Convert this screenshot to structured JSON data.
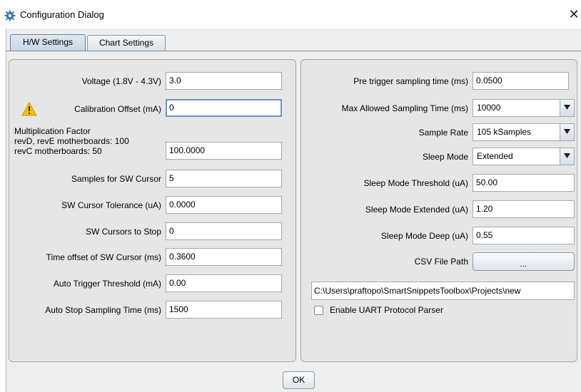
{
  "window": {
    "title": "Configuration Dialog",
    "close_glyph": "✕"
  },
  "icons": {
    "app": "gear-icon",
    "warning": "warning-icon",
    "dropdown": "chevron-down-icon"
  },
  "tabs": [
    {
      "label": "H/W Settings",
      "active": true
    },
    {
      "label": "Chart Settings",
      "active": false
    }
  ],
  "hw": {
    "voltage": {
      "label": "Voltage (1.8V - 4.3V)",
      "value": "3.0"
    },
    "calibration": {
      "label": "Calibration Offset (mA)",
      "value": "0"
    },
    "multiplication": {
      "label_line1": "Multiplication Factor",
      "label_line2": "revD, revE motherboards: 100",
      "label_line3": "revC motherboards: 50",
      "value": "100.0000"
    },
    "samples_sw_cursor": {
      "label": "Samples for SW Cursor",
      "value": "5"
    },
    "sw_cursor_tolerance": {
      "label": "SW Cursor Tolerance (uA)",
      "value": "0.0000"
    },
    "sw_cursors_to_stop": {
      "label": "SW Cursors to Stop",
      "value": "0"
    },
    "time_offset_sw_cursor": {
      "label": "Time offset of SW Cursor (ms)",
      "value": "0.3600"
    },
    "auto_trigger_threshold": {
      "label": "Auto Trigger Threshold (mA)",
      "value": "0.00"
    },
    "auto_stop_sampling": {
      "label": "Auto Stop Sampling Time (ms)",
      "value": "1500"
    }
  },
  "right": {
    "pre_trigger": {
      "label": "Pre trigger sampling time (ms)",
      "value": "0.0500"
    },
    "max_sampling": {
      "label": "Max Allowed Sampling Time (ms)",
      "value": "10000"
    },
    "sample_rate": {
      "label": "Sample Rate",
      "value": "105 kSamples"
    },
    "sleep_mode": {
      "label": "Sleep Mode",
      "value": "Extended"
    },
    "sleep_threshold": {
      "label": "Sleep Mode Threshold (uA)",
      "value": "50.00"
    },
    "sleep_extended": {
      "label": "Sleep Mode Extended (uA)",
      "value": "1.20"
    },
    "sleep_deep": {
      "label": "Sleep Mode Deep (uA)",
      "value": "0.55"
    },
    "csv": {
      "label": "CSV File Path",
      "button": "...",
      "path": "C:\\Users\\praftopo\\SmartSnippetsToolbox\\Projects\\new"
    },
    "uart": {
      "label": "Enable UART Protocol Parser",
      "checked": false
    }
  },
  "footer": {
    "ok": "OK"
  },
  "colors": {
    "warning": "#f2c200",
    "focus_border": "#6f94c4"
  }
}
